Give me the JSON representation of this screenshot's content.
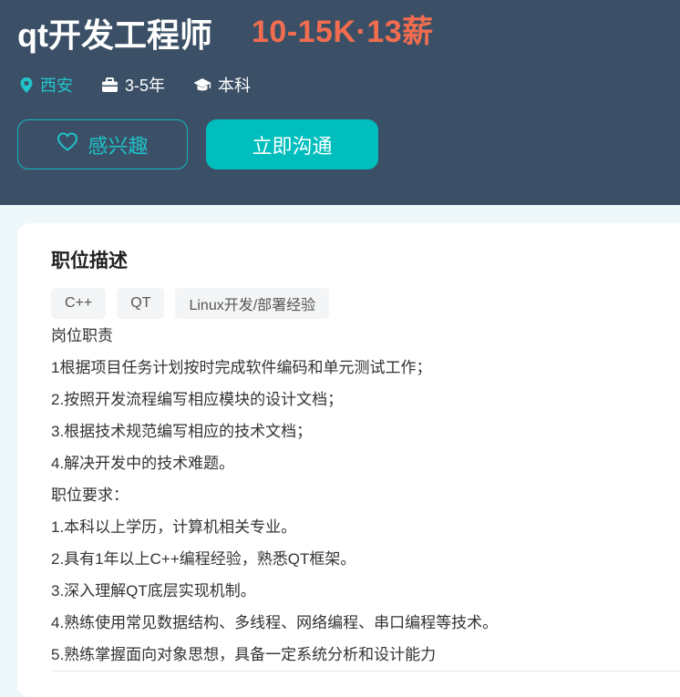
{
  "job": {
    "title": "qt开发工程师",
    "salary": "10-15K·13薪",
    "city": "西安",
    "experience": "3-5年",
    "education": "本科"
  },
  "icons": {
    "city": "location-pin-icon",
    "experience": "briefcase-icon",
    "education": "graduation-cap-icon",
    "interest": "heart-icon"
  },
  "actions": {
    "interest_label": "感兴趣",
    "chat_label": "立即沟通"
  },
  "colors": {
    "header_bg": "#3b5066",
    "accent": "#00bebd",
    "salary": "#f26d50"
  },
  "description": {
    "title": "职位描述",
    "tags": [
      "C++",
      "QT",
      "Linux开发/部署经验"
    ],
    "lines": [
      "岗位职责",
      "1根据项目任务计划按时完成软件编码和单元测试工作；",
      "2.按照开发流程编写相应模块的设计文档；",
      "3.根据技术规范编写相应的技术文档；",
      "4.解决开发中的技术难题。",
      "职位要求：",
      "1.本科以上学历，计算机相关专业。",
      "2.具有1年以上C++编程经验，熟悉QT框架。",
      "3.深入理解QT底层实现机制。",
      "4.熟练使用常见数据结构、多线程、网络编程、串口编程等技术。",
      "5.熟练掌握面向对象思想，具备一定系统分析和设计能力"
    ]
  }
}
